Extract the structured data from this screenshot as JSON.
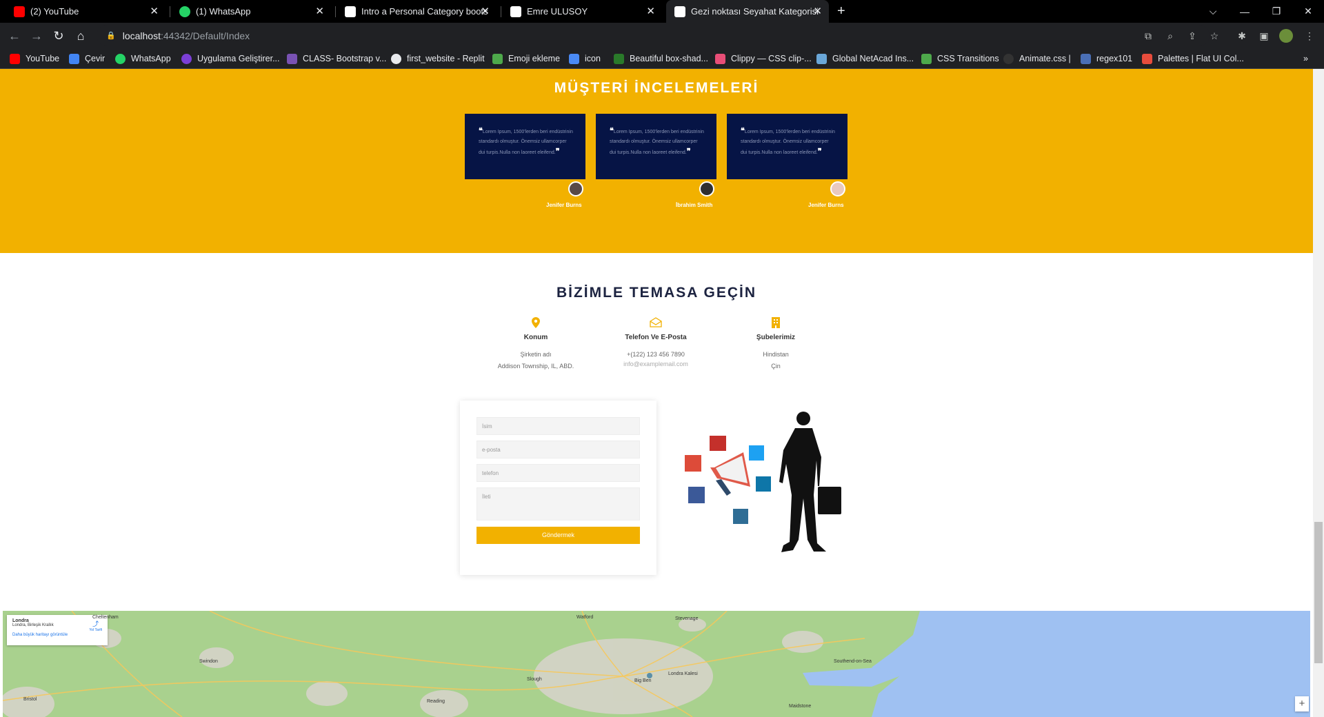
{
  "tabs": [
    {
      "label": "(2) YouTube",
      "icon": "youtube-icon",
      "color": "#ff0000"
    },
    {
      "label": "(1) WhatsApp",
      "icon": "whatsapp-icon",
      "color": "#25d366"
    },
    {
      "label": "Intro a Personal Category bootst",
      "icon": "page-icon",
      "color": "#ffffff"
    },
    {
      "label": "Emre ULUSOY",
      "icon": "page-icon",
      "color": "#ffffff"
    },
    {
      "label": "Gezi noktası Seyahat Kategorisi D",
      "icon": "page-icon",
      "color": "#ffffff"
    }
  ],
  "address": {
    "host": "localhost",
    "path": ":44342/Default/Index"
  },
  "bookmarks": [
    {
      "label": "YouTube",
      "color": "#ff0000"
    },
    {
      "label": "Çevir",
      "color": "#4285f4"
    },
    {
      "label": "WhatsApp",
      "color": "#25d366"
    },
    {
      "label": "Uygulama Geliştirer...",
      "color": "#7b3fd6"
    },
    {
      "label": "CLASS- Bootstrap v...",
      "color": "#7952b3"
    },
    {
      "label": "first_website - Replit",
      "color": "#e8eaed"
    },
    {
      "label": "Emoji ekleme",
      "color": "#4ea94b"
    },
    {
      "label": "icon",
      "color": "#4a8af4"
    },
    {
      "label": "Beautiful box-shad...",
      "color": "#2a7a2a"
    },
    {
      "label": "Clippy — CSS clip-...",
      "color": "#e94e77"
    },
    {
      "label": "Global NetAcad Ins...",
      "color": "#6aa7d8"
    },
    {
      "label": "CSS Transitions",
      "color": "#4ea94b"
    },
    {
      "label": "Animate.css |",
      "color": "#333333"
    },
    {
      "label": "regex101",
      "color": "#4a6fb5"
    },
    {
      "label": "Palettes | Flat UI Col...",
      "color": "#e74c3c"
    }
  ],
  "reviews": {
    "title": "MÜŞTERİ İNCELEMELERİ",
    "items": [
      {
        "text": "Lorem Ipsum, 1500'lerden beri endüstrinin standardı olmuştur. Önemsiz ullamcorper dui turpis.Nulla non laoreet eleifend.",
        "name": "Jenifer Burns"
      },
      {
        "text": "Lorem Ipsum, 1500'lerden beri endüstrinin standardı olmuştur. Önemsiz ullamcorper dui turpis.Nulla non laoreet eleifend.",
        "name": "İbrahim Smith"
      },
      {
        "text": "Lorem Ipsum, 1500'lerden beri endüstrinin standardı olmuştur. Önemsiz ullamcorper dui turpis.Nulla non laoreet eleifend.",
        "name": "Jenifer Burns"
      }
    ]
  },
  "contact": {
    "title": "BİZİMLE TEMASA GEÇİN",
    "blocks": [
      {
        "icon": "location-pin-icon",
        "heading": "Konum",
        "line1": "Şirketin adı",
        "line2": "Addison Township, IL, ABD."
      },
      {
        "icon": "envelope-icon",
        "heading": "Telefon Ve E-Posta",
        "line1": "+(122) 123 456 7890",
        "line2": "info@examplemail.com"
      },
      {
        "icon": "building-icon",
        "heading": "Şubelerimiz",
        "line1": "Hindistan",
        "line2": "Çin"
      }
    ]
  },
  "form": {
    "name_placeholder": "İsim",
    "email_placeholder": "e-posta",
    "phone_placeholder": "telefon",
    "message_placeholder": "İleti",
    "submit_label": "Göndermek"
  },
  "map": {
    "place": "Londra",
    "subtitle": "Londra, Birleşik Krallık",
    "directions": "Yol Tarifi",
    "larger_map": "Daha büyük haritayı görüntüle",
    "zoom_in": "+",
    "labels": [
      "Watford",
      "Slough",
      "Reading",
      "Big Ben",
      "Londra Kalesi",
      "Southend-on-Sea",
      "Maidstone",
      "Swindon",
      "Bristol",
      "Cheltenham",
      "Stevenage"
    ]
  },
  "colors": {
    "accent": "#f2b100",
    "card": "#061445",
    "title_dark": "#1c2340"
  }
}
